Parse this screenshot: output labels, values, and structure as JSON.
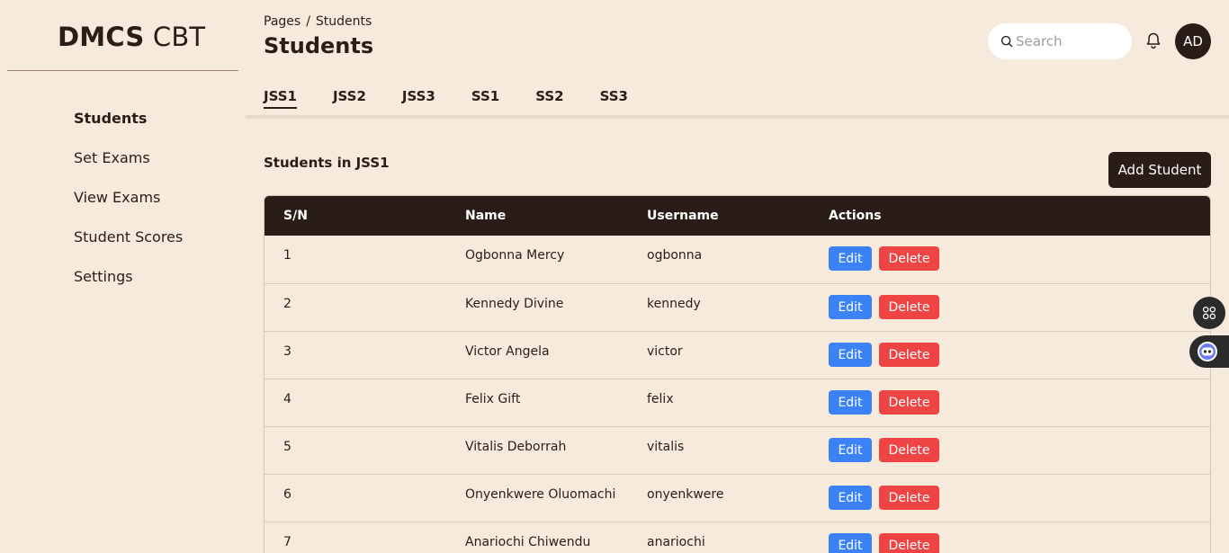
{
  "brand": {
    "bold": "DMCS",
    "light": " CBT"
  },
  "sidebar": {
    "items": [
      {
        "label": "Students",
        "active": true
      },
      {
        "label": "Set Exams"
      },
      {
        "label": "View Exams"
      },
      {
        "label": "Student Scores"
      },
      {
        "label": "Settings"
      }
    ]
  },
  "header": {
    "breadcrumb": [
      "Pages",
      "/",
      "Students"
    ],
    "title": "Students",
    "search_placeholder": "Search",
    "avatar_initials": "AD"
  },
  "tabs": [
    "JSS1",
    "JSS2",
    "JSS3",
    "SS1",
    "SS2",
    "SS3"
  ],
  "active_tab": "JSS1",
  "section": {
    "title": "Students in JSS1",
    "add_button": "Add Student"
  },
  "table": {
    "columns": [
      "S/N",
      "Name",
      "Username",
      "Actions"
    ],
    "edit_label": "Edit",
    "delete_label": "Delete",
    "rows": [
      {
        "sn": "1",
        "name": "Ogbonna Mercy",
        "username": "ogbonna"
      },
      {
        "sn": "2",
        "name": "Kennedy Divine",
        "username": "kennedy"
      },
      {
        "sn": "3",
        "name": "Victor Angela",
        "username": "victor"
      },
      {
        "sn": "4",
        "name": "Felix Gift",
        "username": "felix"
      },
      {
        "sn": "5",
        "name": "Vitalis Deborrah",
        "username": "vitalis"
      },
      {
        "sn": "6",
        "name": "Onyenkwere Oluomachi",
        "username": "onyenkwere"
      },
      {
        "sn": "7",
        "name": "Anariochi Chiwendu",
        "username": "anariochi"
      }
    ]
  },
  "colors": {
    "background": "#f5eadb",
    "dark": "#2a1d17",
    "edit": "#3b82f6",
    "delete": "#ef4444"
  },
  "icons": [
    "search-icon",
    "bell-icon",
    "apps-grid-icon",
    "assistant-bot-icon"
  ]
}
